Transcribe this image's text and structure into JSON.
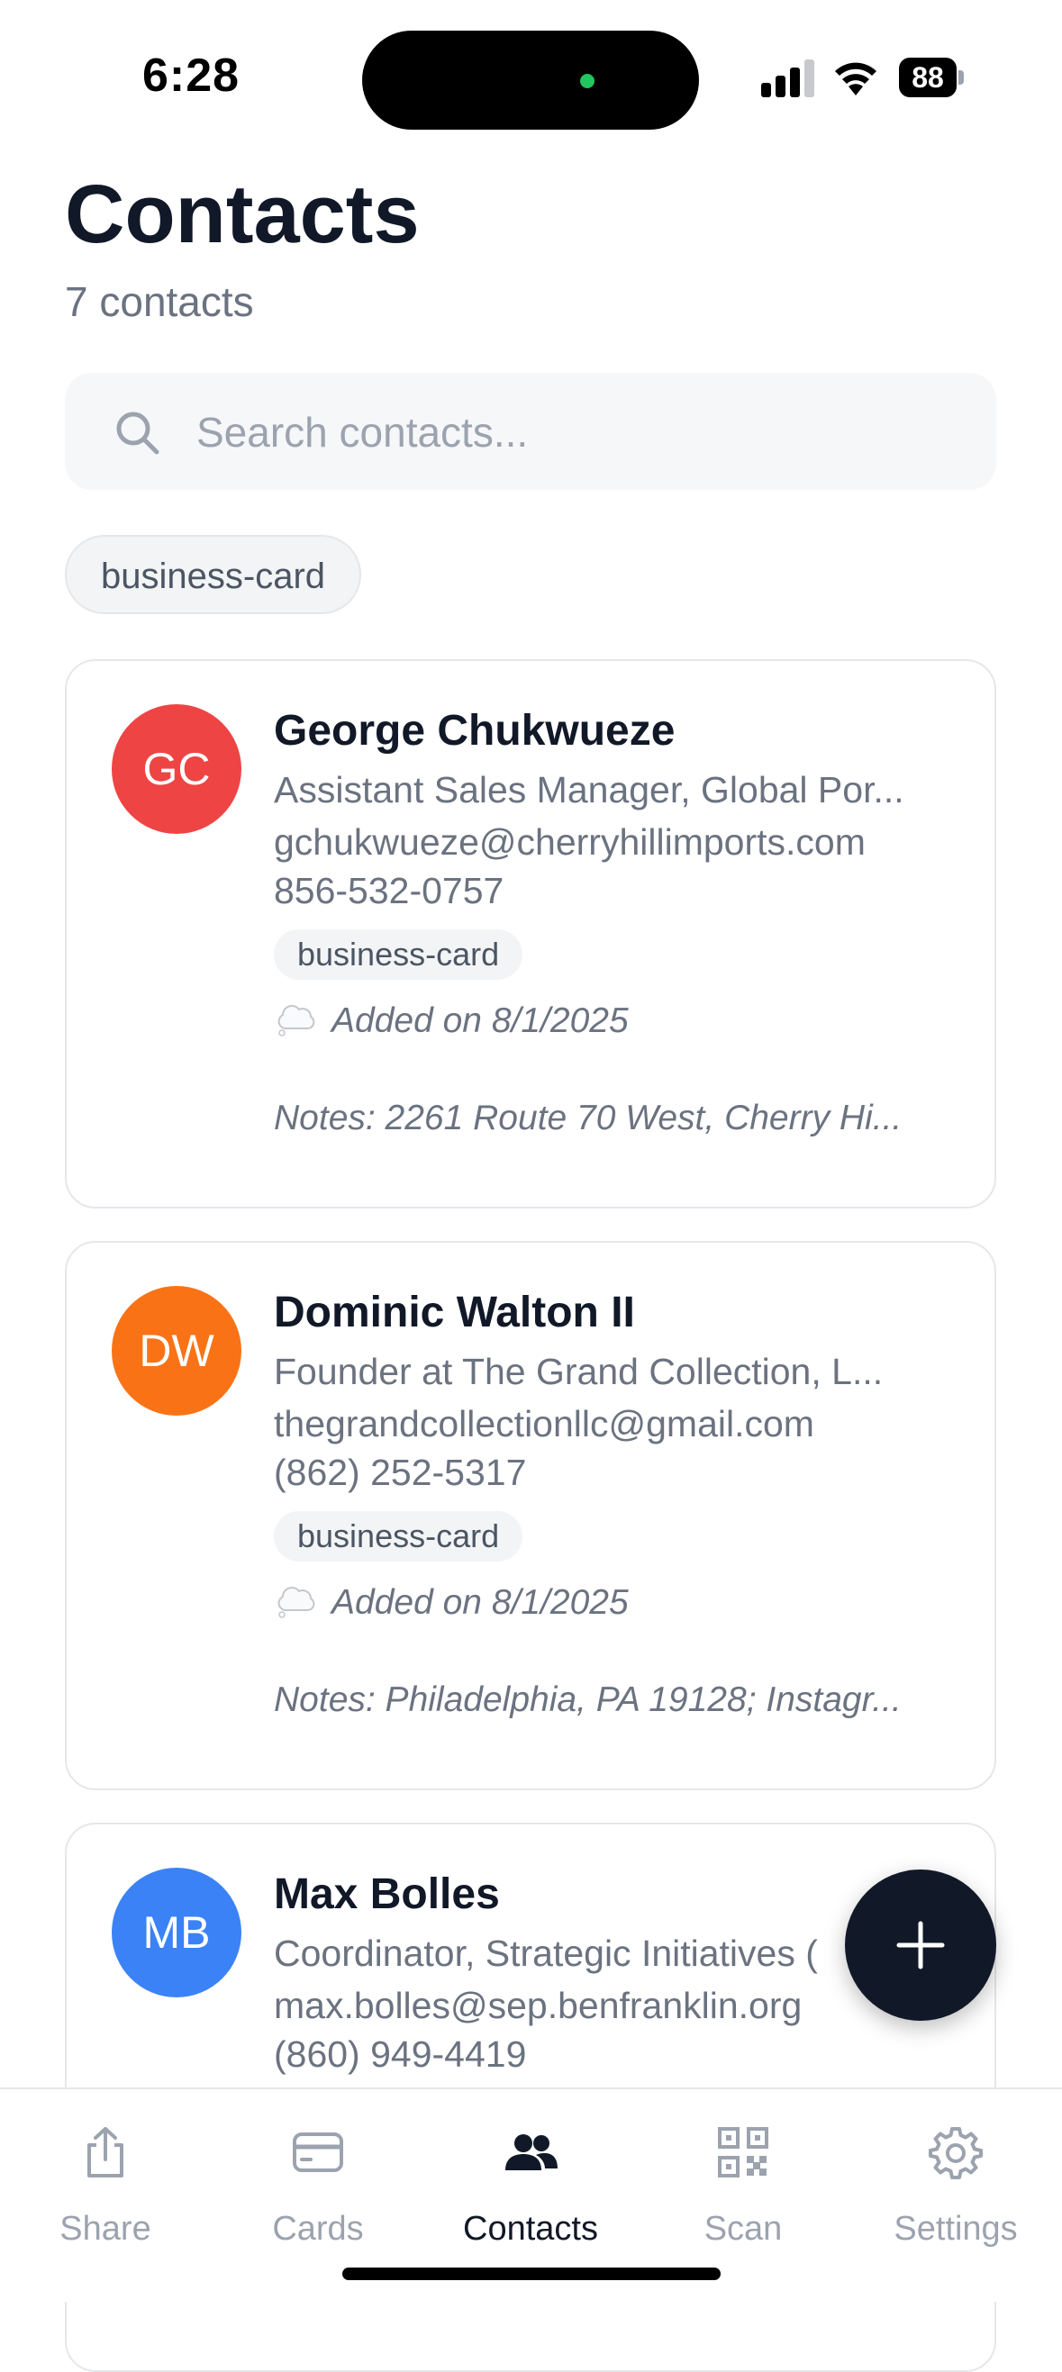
{
  "status_bar": {
    "time": "6:28",
    "battery": "88"
  },
  "header": {
    "title": "Contacts",
    "count": "7 contacts"
  },
  "search": {
    "placeholder": "Search contacts..."
  },
  "filters": [
    "business-card"
  ],
  "contacts": [
    {
      "initials": "GC",
      "avatar_color": "#ef4444",
      "name": "George Chukwueze",
      "title": "Assistant Sales Manager, Global Por...",
      "email": "gchukwueze@cherryhillimports.com",
      "phone": "856-532-0757",
      "tag": "business-card",
      "added": "Added on 8/1/2025",
      "notes": "Notes: 2261 Route 70 West, Cherry Hi..."
    },
    {
      "initials": "DW",
      "avatar_color": "#f97316",
      "name": "Dominic Walton II",
      "title": "Founder at The Grand Collection, L...",
      "email": "thegrandcollectionllc@gmail.com",
      "phone": "(862) 252-5317",
      "tag": "business-card",
      "added": "Added on 8/1/2025",
      "notes": "Notes: Philadelphia, PA 19128; Instagr..."
    },
    {
      "initials": "MB",
      "avatar_color": "#3b82f6",
      "name": "Max Bolles",
      "title": "Coordinator, Strategic Initiatives (",
      "email": "max.bolles@sep.benfranklin.org",
      "phone": "(860) 949-4419"
    }
  ],
  "tabs": [
    {
      "label": "Share",
      "icon": "share-icon"
    },
    {
      "label": "Cards",
      "icon": "card-icon"
    },
    {
      "label": "Contacts",
      "icon": "people-icon",
      "active": true
    },
    {
      "label": "Scan",
      "icon": "qr-code-icon"
    },
    {
      "label": "Settings",
      "icon": "gear-icon"
    }
  ],
  "colors": {
    "primary": "#111827",
    "muted": "#6b7280",
    "border": "#e5e7eb"
  }
}
